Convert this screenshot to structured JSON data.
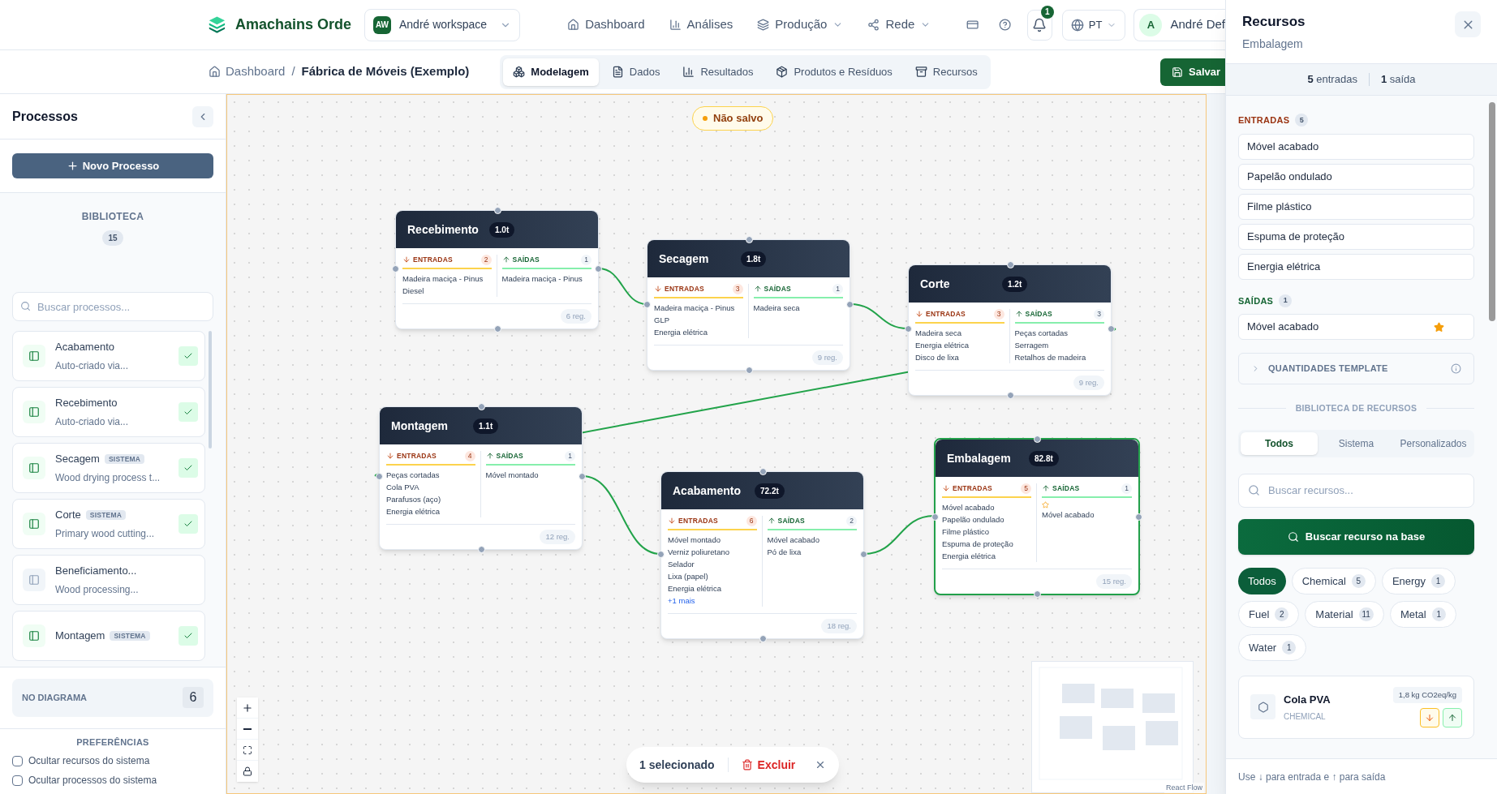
{
  "topbar": {
    "brand": "Amachains Orde",
    "workspace": {
      "initials": "AW",
      "name": "André workspace"
    },
    "nav": [
      {
        "label": "Dashboard",
        "dropdown": false
      },
      {
        "label": "Análises",
        "dropdown": false
      },
      {
        "label": "Produção",
        "dropdown": true
      },
      {
        "label": "Rede",
        "dropdown": true
      }
    ],
    "notifications": "1",
    "language": "PT",
    "user": {
      "initial": "A",
      "name": "André Def"
    }
  },
  "header": {
    "breadcrumb": [
      "Dashboard",
      "Fábrica de Móveis (Exemplo)"
    ],
    "separator": "/",
    "tabs": [
      {
        "label": "Modelagem",
        "selected": true
      },
      {
        "label": "Dados",
        "selected": false
      },
      {
        "label": "Resultados",
        "selected": false
      },
      {
        "label": "Produtos e Resíduos",
        "selected": false
      },
      {
        "label": "Recursos",
        "selected": false
      }
    ],
    "save": "Salvar"
  },
  "sidebar": {
    "title": "Processos",
    "new_button": "Novo Processo",
    "library": {
      "title": "BIBLIOTECA",
      "count": "15"
    },
    "search": {
      "placeholder": "Buscar processos..."
    },
    "processes": [
      {
        "name": "Acabamento",
        "description": "Auto-criado via...",
        "in_diagram": true
      },
      {
        "name": "Recebimento",
        "description": "Auto-criado via...",
        "in_diagram": true
      },
      {
        "name": "Secagem",
        "badge": "SISTEMA",
        "description": "Wood drying process t...",
        "in_diagram": true
      },
      {
        "name": "Corte",
        "badge": "SISTEMA",
        "description": "Primary wood cutting...",
        "in_diagram": true
      },
      {
        "name": "Beneficiamento...",
        "description": "Wood processing...",
        "in_diagram": false
      },
      {
        "name": "Montagem",
        "badge": "SISTEMA",
        "in_diagram": true
      }
    ],
    "in_diagram": {
      "label": "NO DIAGRAMA",
      "count": "6"
    },
    "preferences": {
      "title": "PREFERÊNCIAS",
      "options": [
        {
          "label": "Ocultar recursos do sistema",
          "checked": false
        },
        {
          "label": "Ocultar processos do sistema",
          "checked": false
        }
      ]
    }
  },
  "canvas": {
    "status": "Não salvo",
    "nodes": [
      {
        "name": "Recebimento",
        "mass": "1.0t",
        "inputs_label": "ENTRADAS",
        "inputs_count": "2",
        "inputs": [
          "Madeira maciça - Pinus",
          "Diesel"
        ],
        "outputs_label": "SAÍDAS",
        "outputs_count": "1",
        "outputs": [
          {
            "name": "Madeira maciça - Pinus",
            "starred": false
          }
        ],
        "records": "6 reg.",
        "selected": false
      },
      {
        "name": "Secagem",
        "mass": "1.8t",
        "inputs_label": "ENTRADAS",
        "inputs_count": "3",
        "inputs": [
          "Madeira maciça - Pinus",
          "GLP",
          "Energia elétrica"
        ],
        "outputs_label": "SAÍDAS",
        "outputs_count": "1",
        "outputs": [
          {
            "name": "Madeira seca",
            "starred": false
          }
        ],
        "records": "9 reg.",
        "selected": false
      },
      {
        "name": "Corte",
        "mass": "1.2t",
        "inputs_label": "ENTRADAS",
        "inputs_count": "3",
        "inputs": [
          "Madeira seca",
          "Energia elétrica",
          "Disco de lixa"
        ],
        "outputs_label": "SAÍDAS",
        "outputs_count": "3",
        "outputs": [
          {
            "name": "Peças cortadas",
            "starred": false
          },
          {
            "name": "Serragem",
            "starred": false
          },
          {
            "name": "Retalhos de madeira",
            "starred": false
          }
        ],
        "records": "9 reg.",
        "selected": false
      },
      {
        "name": "Montagem",
        "mass": "1.1t",
        "inputs_label": "ENTRADAS",
        "inputs_count": "4",
        "inputs": [
          "Peças cortadas",
          "Cola PVA",
          "Parafusos (aço)",
          "Energia elétrica"
        ],
        "outputs_label": "SAÍDAS",
        "outputs_count": "1",
        "outputs": [
          {
            "name": "Móvel montado",
            "starred": false
          }
        ],
        "records": "12 reg.",
        "selected": false
      },
      {
        "name": "Acabamento",
        "mass": "72.2t",
        "inputs_label": "ENTRADAS",
        "inputs_count": "6",
        "inputs": [
          "Móvel montado",
          "Verniz poliuretano",
          "Selador",
          "Lixa (papel)",
          "Energia elétrica"
        ],
        "more": "+1 mais",
        "outputs_label": "SAÍDAS",
        "outputs_count": "2",
        "outputs": [
          {
            "name": "Móvel acabado",
            "starred": false
          },
          {
            "name": "Pó de lixa",
            "starred": false
          }
        ],
        "records": "18 reg.",
        "selected": false
      },
      {
        "name": "Embalagem",
        "mass": "82.8t",
        "inputs_label": "ENTRADAS",
        "inputs_count": "5",
        "inputs": [
          "Móvel acabado",
          "Papelão ondulado",
          "Filme plástico",
          "Espuma de proteção",
          "Energia elétrica"
        ],
        "outputs_label": "SAÍDAS",
        "outputs_count": "1",
        "outputs": [
          {
            "name": "Móvel acabado",
            "starred": true
          }
        ],
        "records": "15 reg.",
        "selected": true
      }
    ],
    "selection": {
      "count_text": "1 selecionado",
      "delete": "Excluir"
    },
    "attribution": "React Flow"
  },
  "panel": {
    "title": "Recursos",
    "subtitle": "Embalagem",
    "summary": [
      {
        "count": "5",
        "label": "entradas"
      },
      {
        "count": "1",
        "label": "saída"
      }
    ],
    "inputs": {
      "title": "ENTRADAS",
      "count": "5",
      "items": [
        {
          "name": "Móvel acabado",
          "starred": false
        },
        {
          "name": "Papelão ondulado",
          "starred": false
        },
        {
          "name": "Filme plástico",
          "starred": false
        },
        {
          "name": "Espuma de proteção",
          "starred": false
        },
        {
          "name": "Energia elétrica",
          "starred": false
        }
      ]
    },
    "outputs": {
      "title": "SAÍDAS",
      "count": "1",
      "items": [
        {
          "name": "Móvel acabado",
          "starred": true
        }
      ]
    },
    "template": {
      "title": "QUANTIDADES TEMPLATE",
      "expanded": false
    },
    "library": {
      "title": "BIBLIOTECA DE RECURSOS",
      "tabs": [
        {
          "label": "Todos",
          "selected": true
        },
        {
          "label": "Sistema",
          "selected": false
        },
        {
          "label": "Personalizados",
          "selected": false
        }
      ],
      "search": {
        "placeholder": "Buscar recursos..."
      },
      "search_button": "Buscar recurso na base",
      "filters": [
        {
          "label": "Todos",
          "selected": true
        },
        {
          "label": "Chemical",
          "count": "5",
          "selected": false
        },
        {
          "label": "Energy",
          "count": "1",
          "selected": false
        },
        {
          "label": "Fuel",
          "count": "2",
          "selected": false
        },
        {
          "label": "Material",
          "count": "11",
          "selected": false
        },
        {
          "label": "Metal",
          "count": "1",
          "selected": false
        },
        {
          "label": "Water",
          "count": "1",
          "selected": false
        }
      ],
      "resources": [
        {
          "name": "Cola PVA",
          "category": "CHEMICAL",
          "factor": "1,8 kg CO2eq/kg"
        }
      ]
    },
    "hint": "Use ↓ para entrada e ↑ para saída"
  }
}
